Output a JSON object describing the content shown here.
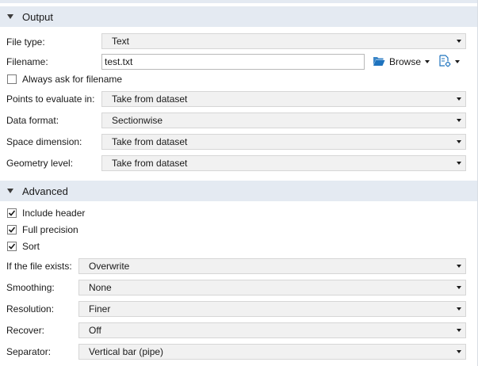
{
  "output": {
    "title": "Output",
    "file_type": {
      "label": "File type:",
      "value": "Text"
    },
    "filename": {
      "label": "Filename:",
      "value": "test.txt",
      "browse_label": "Browse"
    },
    "always_ask": {
      "label": "Always ask for filename",
      "checked": false
    },
    "points": {
      "label": "Points to evaluate in:",
      "value": "Take from dataset"
    },
    "data_format": {
      "label": "Data format:",
      "value": "Sectionwise"
    },
    "space_dimension": {
      "label": "Space dimension:",
      "value": "Take from dataset"
    },
    "geometry_level": {
      "label": "Geometry level:",
      "value": "Take from dataset"
    }
  },
  "advanced": {
    "title": "Advanced",
    "include_header": {
      "label": "Include header",
      "checked": true
    },
    "full_precision": {
      "label": "Full precision",
      "checked": true
    },
    "sort": {
      "label": "Sort",
      "checked": true
    },
    "if_exists": {
      "label": "If the file exists:",
      "value": "Overwrite"
    },
    "smoothing": {
      "label": "Smoothing:",
      "value": "None"
    },
    "resolution": {
      "label": "Resolution:",
      "value": "Finer"
    },
    "recover": {
      "label": "Recover:",
      "value": "Off"
    },
    "separator": {
      "label": "Separator:",
      "value": "Vertical bar (pipe)"
    }
  },
  "icons": {
    "browse": "folder-open-icon",
    "file_options": "file-options-icon"
  },
  "colors": {
    "section_header_bg": "#e4eaf2",
    "combo_bg": "#f1f1f1",
    "folder_blue": "#1e73be"
  }
}
